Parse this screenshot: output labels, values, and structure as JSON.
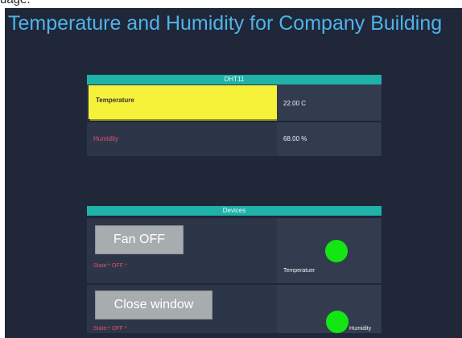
{
  "top_strip_text": "uage.",
  "title": "Temperature and Humidity for Company Building",
  "dht": {
    "header": "DHT11",
    "temperature_label": "Temperature",
    "temperature_value": "22.00 C",
    "humidity_label": "Humidity",
    "humidity_value": "68.00 %"
  },
  "devices": {
    "header": "Devices",
    "items": [
      {
        "button": "Fan OFF",
        "state": "State:* OFF *",
        "indicator": "Temperatuer",
        "indicator_color": "#13e613"
      },
      {
        "button": "Close window",
        "state": "State:* OFF *",
        "indicator": "Humidity",
        "indicator_color": "#13e613"
      }
    ]
  },
  "colors": {
    "background": "#1f2738",
    "title": "#4fb3ea",
    "header": "#1fb2a8",
    "highlight": "#f6f23a",
    "state_text": "#e04f6a"
  }
}
